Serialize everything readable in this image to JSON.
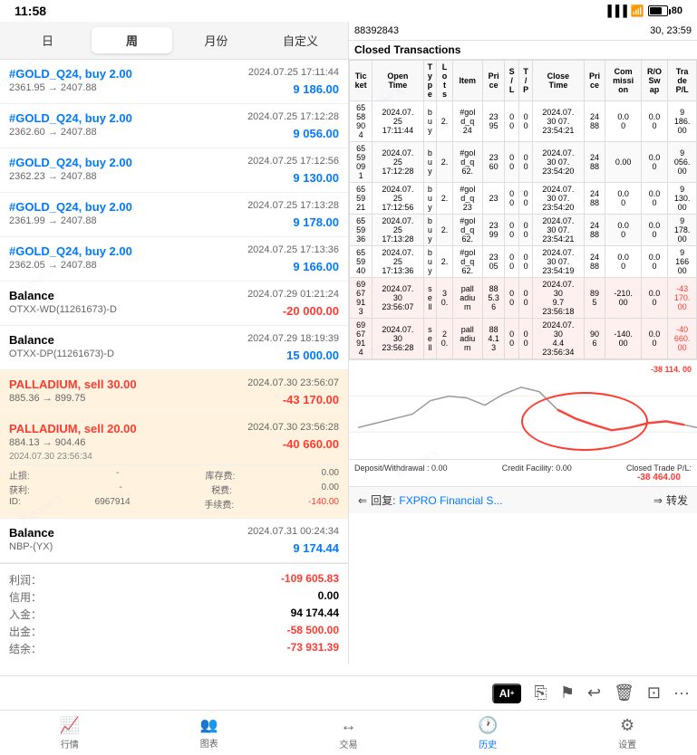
{
  "statusBar": {
    "time": "11:58",
    "batteryPercent": "80"
  },
  "tabs": [
    {
      "label": "日",
      "active": false
    },
    {
      "label": "周",
      "active": true
    },
    {
      "label": "月份",
      "active": false
    },
    {
      "label": "自定义",
      "active": false
    }
  ],
  "transactions": [
    {
      "id": "tx1",
      "title": "#GOLD_Q24, buy 2.00",
      "date": "2024.07.25 17:11:44",
      "price": "2361.95 → 2407.88",
      "profit": "9 186.00",
      "profitType": "positive"
    },
    {
      "id": "tx2",
      "title": "#GOLD_Q24, buy 2.00",
      "date": "2024.07.25 17:12:28",
      "price": "2362.60 → 2407.88",
      "profit": "9 056.00",
      "profitType": "positive"
    },
    {
      "id": "tx3",
      "title": "#GOLD_Q24, buy 2.00",
      "date": "2024.07.25 17:12:56",
      "price": "2362.23 → 2407.88",
      "profit": "9 130.00",
      "profitType": "positive"
    },
    {
      "id": "tx4",
      "title": "#GOLD_Q24, buy 2.00",
      "date": "2024.07.25 17:13:28",
      "price": "2361.99 → 2407.88",
      "profit": "9 178.00",
      "profitType": "positive"
    },
    {
      "id": "tx5",
      "title": "#GOLD_Q24, buy 2.00",
      "date": "2024.07.25 17:13:36",
      "price": "2362.05 → 2407.88",
      "profit": "9 166.00",
      "profitType": "positive"
    },
    {
      "id": "bal1",
      "type": "balance",
      "title": "Balance",
      "date": "2024.07.29 01:21:24",
      "sub": "OTXX-WD(11261673)-D",
      "profit": "-20 000.00",
      "profitType": "negative"
    },
    {
      "id": "bal2",
      "type": "balance",
      "title": "Balance",
      "date": "2024.07.29 18:19:39",
      "sub": "OTXX-DP(11261673)-D",
      "profit": "15 000.00",
      "profitType": "positive"
    },
    {
      "id": "tx6",
      "title": "PALLADIUM, sell 30.00",
      "date": "2024.07.30 23:56:07",
      "price": "885.36 → 899.75",
      "profit": "-43 170.00",
      "profitType": "negative",
      "selected": true
    },
    {
      "id": "tx7",
      "title": "PALLADIUM, sell 20.00",
      "date": "2024.07.30 23:56:28",
      "price": "884.13 → 904.46",
      "profit": "-40 660.00",
      "profitType": "negative",
      "selected": true,
      "extra": "2024.07.30 23:56:34"
    },
    {
      "id": "bal3",
      "type": "balance",
      "title": "Balance",
      "date": "2024.07.31 00:24:34",
      "sub": "NBP-(YX)",
      "profit": "9 174.44",
      "profitType": "positive"
    }
  ],
  "detailsSection": {
    "headerId": "88392843",
    "headerDate": "30, 23:59",
    "sectionTitle": "Closed Transactions",
    "tableHeaders": [
      "Ticket",
      "Open Time",
      "Type",
      "Lots",
      "Item",
      "Price",
      "S/L",
      "T/P",
      "Close Time",
      "Price",
      "Commission",
      "R/O Swap",
      "Trade P/L"
    ],
    "tableRows": [
      [
        "65 58 90 4",
        "2024.07. 25 17:11:44",
        "b u y",
        "2.",
        "#gol d_q 24",
        "23 95",
        "0 0",
        "0 0",
        "2024.07. 30 07. 23:54:21",
        "24 88",
        "0.0 0",
        "0.0 0",
        "9 186. 00"
      ],
      [
        "65 59 09 1",
        "2024.07. 25 17:12:28",
        "b u y",
        "2.",
        "#gol d_q 62.",
        "23 60",
        "0 0",
        "0 0",
        "2024.07. 30 07. 23:54:20",
        "24 88",
        "0.00",
        "0.0 0",
        "9 056. 00"
      ],
      [
        "65 59 21",
        "2024.07. 25 17:12:56",
        "b u y",
        "2.",
        "#gol d_q 23",
        "23",
        "0 0",
        "0 0",
        "2024.07. 30 07. 23:54:20",
        "24 88",
        "0.0 0",
        "0.0 0",
        "9 130. 00"
      ],
      [
        "65 59 36",
        "2024.07. 25 17:13:28",
        "b u y",
        "2.",
        "#gol d_q 62.",
        "23 99",
        "0 0",
        "0 0",
        "2024.07. 30 07. 23:54:21",
        "24 88",
        "0.0 0",
        "0.0 0",
        "9 178. 00"
      ],
      [
        "65 59 40",
        "2024.07. 25 17:13:36",
        "b u y",
        "2.",
        "#gol d_q 62.",
        "23 05",
        "0 0",
        "0 0",
        "2024.07. 30 07. 23:54:19",
        "24 88",
        "0.0 0",
        "0.0 0",
        "9 166 00"
      ],
      [
        "69 67 91 3",
        "2024.07. 30 23:56:07",
        "s e ll",
        "3 0.",
        "pall adiu m",
        "88 5.3 6",
        "0 0",
        "0 0",
        "2024.07. 30 9.7 23:56:18",
        "89 5",
        "-210. 00",
        "0.0 0",
        "-43 170. 00"
      ],
      [
        "69 67 91 4",
        "2024.07. 30 23:56:28",
        "s e ll",
        "2 0.",
        "pall adiu m",
        "88 4.1 3",
        "0 0",
        "0 0",
        "2024.07. 30 4.4 23:56:34",
        "90 6",
        "-140. 00",
        "0.0 0",
        "-40 660. 00"
      ]
    ],
    "bottomRow": {
      "deposit": "Deposit/Withdrawal : 0.00",
      "credit": "Credit Facility: 0.00",
      "closedTrade": "Closed Trade P/L:",
      "closedValue": "-38 464.00"
    },
    "chartData": {
      "points": [
        0.1,
        0.15,
        0.1,
        0.2,
        0.5,
        0.4,
        0.35,
        0.3,
        0.45,
        0.55,
        0.6,
        0.5,
        0.3,
        0.2,
        0.1,
        0.05,
        0.15,
        0.2,
        0.35,
        0.4
      ],
      "negativeValue": "-38 114. 00"
    }
  },
  "summaryLeft": {
    "stopLoss": {
      "label": "止损:",
      "value": "-"
    },
    "storage": {
      "label": "库存费:",
      "value": "0.00"
    },
    "profit": {
      "label": "获利:",
      "value": "-"
    },
    "tax": {
      "label": "税费:",
      "value": "0.00"
    },
    "id": {
      "label": "ID:",
      "value": "6967914"
    },
    "continuousFee": {
      "label": "手续费:",
      "value": "-140.00"
    }
  },
  "summaryTotal": {
    "profit": {
      "label": "利润：",
      "value": "-109 605.83"
    },
    "credit": {
      "label": "信用：",
      "value": "0.00"
    },
    "deposit": {
      "label": "入金：",
      "value": "94 174.44"
    },
    "withdrawal": {
      "label": "出金：",
      "value": "-58 500.00"
    },
    "balance": {
      "label": "结余：",
      "value": "-73 931.39"
    }
  },
  "replyBar": {
    "replyLabel": "⇐ 回复:",
    "replyText": "FXPRO Financial S...",
    "forwardLabel": "⇒ 转发"
  },
  "aiToolbar": {
    "aiLabel": "AI⁺",
    "icons": [
      "📋",
      "🏁",
      "↩",
      "🗑",
      "🔄",
      "···"
    ]
  },
  "bottomNav": {
    "items": [
      {
        "label": "行情",
        "icon": "📈",
        "active": false
      },
      {
        "label": "图表",
        "icon": "👥",
        "active": false
      },
      {
        "label": "交易",
        "icon": "↔",
        "active": false
      },
      {
        "label": "历史",
        "icon": "🕐",
        "active": true
      },
      {
        "label": "设置",
        "icon": "⚙",
        "active": false
      }
    ]
  }
}
